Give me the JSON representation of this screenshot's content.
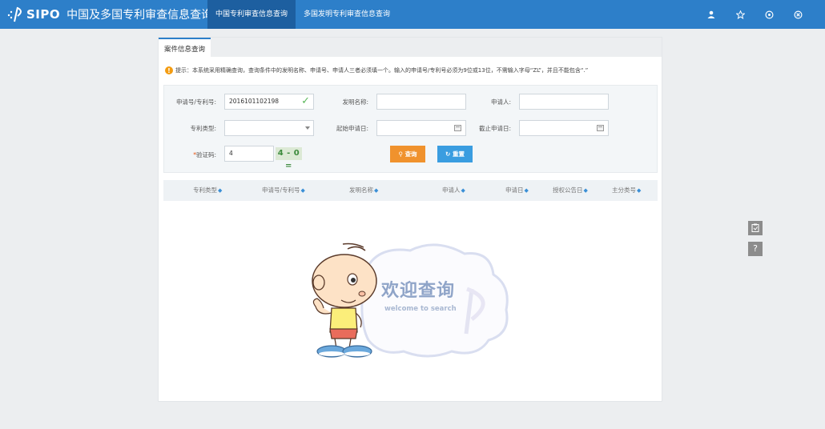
{
  "header": {
    "logo_text": "SIPO",
    "title": "中国及多国专利审查信息查询",
    "tabs": [
      {
        "label": "中国专利审查信息查询",
        "active": true
      },
      {
        "label": "多国发明专利审查信息查询",
        "active": false
      }
    ],
    "icons": [
      "user-icon",
      "star-icon",
      "help-circle-icon",
      "close-circle-icon"
    ]
  },
  "panel": {
    "tab_label": "案件信息查询",
    "notice": "提示：本系统采用精确查询，查询条件中的发明名称、申请号、申请人三者必须填一个。输入的申请号/专利号必须为9位或13位，不需输入字母“ZL”，并且不能包含“.”"
  },
  "form": {
    "app_no_label": "申请号/专利号:",
    "app_no_value": "2016101102198",
    "invention_name_label": "发明名称:",
    "invention_name_value": "",
    "applicant_label": "申请人:",
    "applicant_value": "",
    "patent_type_label": "专利类型:",
    "patent_type_value": "",
    "start_date_label": "起始申请日:",
    "start_date_value": "",
    "end_date_label": "截止申请日:",
    "end_date_value": "",
    "captcha_label": "验证码:",
    "captcha_required": "*",
    "captcha_value": "4",
    "captcha_image_text": "4 - 0 =",
    "search_button": "查询",
    "reset_button": "重置"
  },
  "table": {
    "columns": [
      "专利类型",
      "申请号/专利号",
      "发明名称",
      "申请人",
      "申请日",
      "授权公告日",
      "主分类号"
    ]
  },
  "welcome": {
    "title": "欢迎查询",
    "subtitle": "welcome to search"
  },
  "colors": {
    "header_bg": "#2d7fc9",
    "active_tab_bg": "#1d5fa0",
    "search_button": "#f0922d",
    "reset_button": "#3a9de0",
    "notice_icon": "#f39c12"
  }
}
